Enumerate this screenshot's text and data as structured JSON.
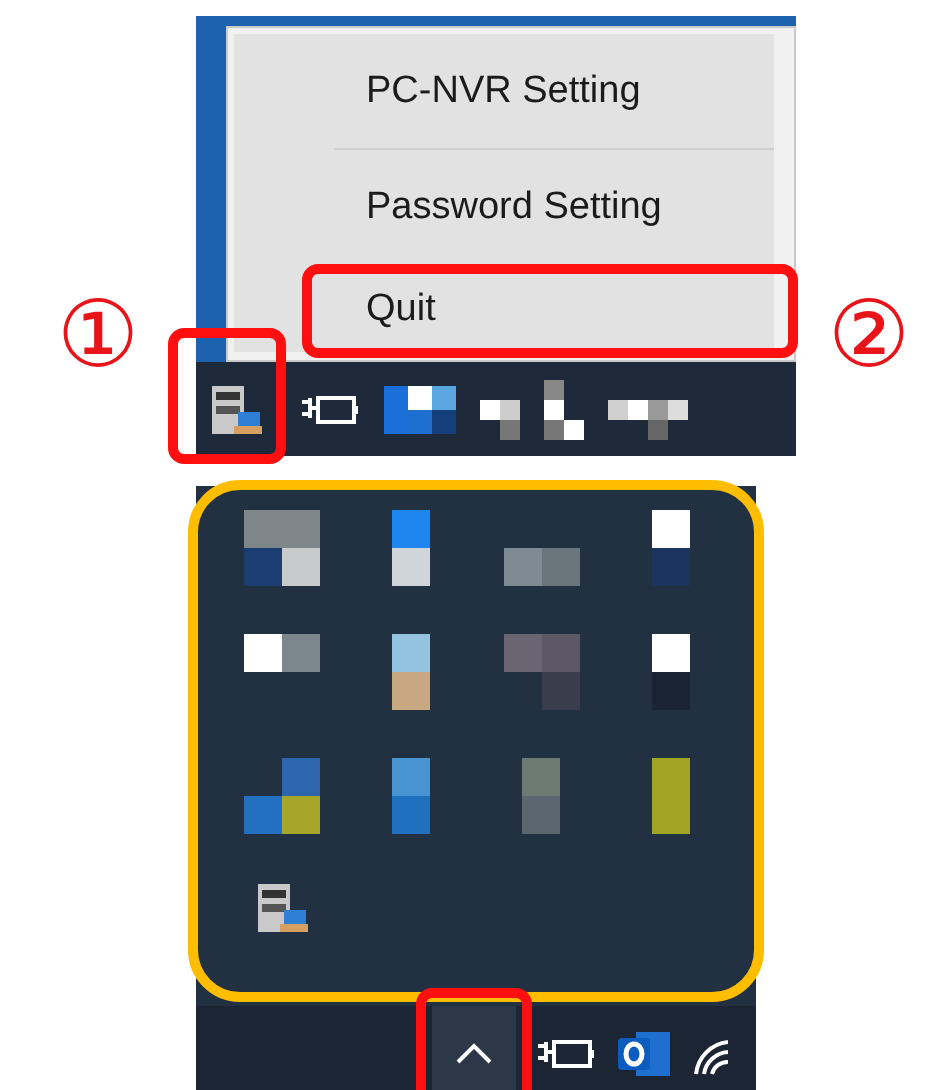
{
  "steps": [
    {
      "label": "①"
    },
    {
      "label": "②"
    }
  ],
  "context_menu": {
    "items": [
      {
        "label": "PC-NVR Setting",
        "highlighted": false
      },
      {
        "label": "Password Setting",
        "highlighted": false
      },
      {
        "label": "Quit",
        "highlighted": true
      }
    ]
  },
  "top_taskbar": {
    "app_icon_highlighted": true
  },
  "overflow_flyout": {
    "highlighted": true
  },
  "bottom_taskbar": {
    "chevron_highlighted": true
  }
}
